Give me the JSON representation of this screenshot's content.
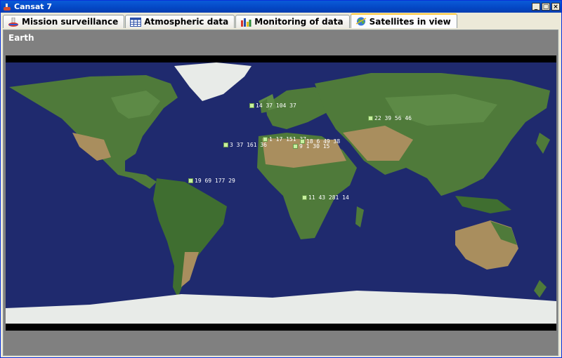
{
  "window": {
    "title": "Cansat 7",
    "controls": [
      "_",
      "□",
      "×"
    ]
  },
  "tabs": [
    {
      "label": "Mission surveillance",
      "icon": "rocket-icon",
      "active": false
    },
    {
      "label": "Atmospheric data",
      "icon": "table-icon",
      "active": false
    },
    {
      "label": "Monitoring of data",
      "icon": "bar-chart-icon",
      "active": false
    },
    {
      "label": "Satellites in view",
      "icon": "globe-icon",
      "active": true
    }
  ],
  "panel": {
    "title": "Earth"
  },
  "satellites": [
    {
      "label": "14 37 104 37"
    },
    {
      "label": "22 39 56 46"
    },
    {
      "label": "1 17 151 37"
    },
    {
      "label": "18 6 49 38"
    },
    {
      "label": "3 37 161 36"
    },
    {
      "label": "9 1 30 15"
    },
    {
      "label": "19 69 177 29"
    },
    {
      "label": "11 43 281 14"
    }
  ],
  "colors": {
    "ocean": "#1f2a6e",
    "land": "#4f7a3a",
    "ice": "#e8ebe8",
    "desert": "#a98e5e",
    "marker": "#c8f0a0"
  }
}
